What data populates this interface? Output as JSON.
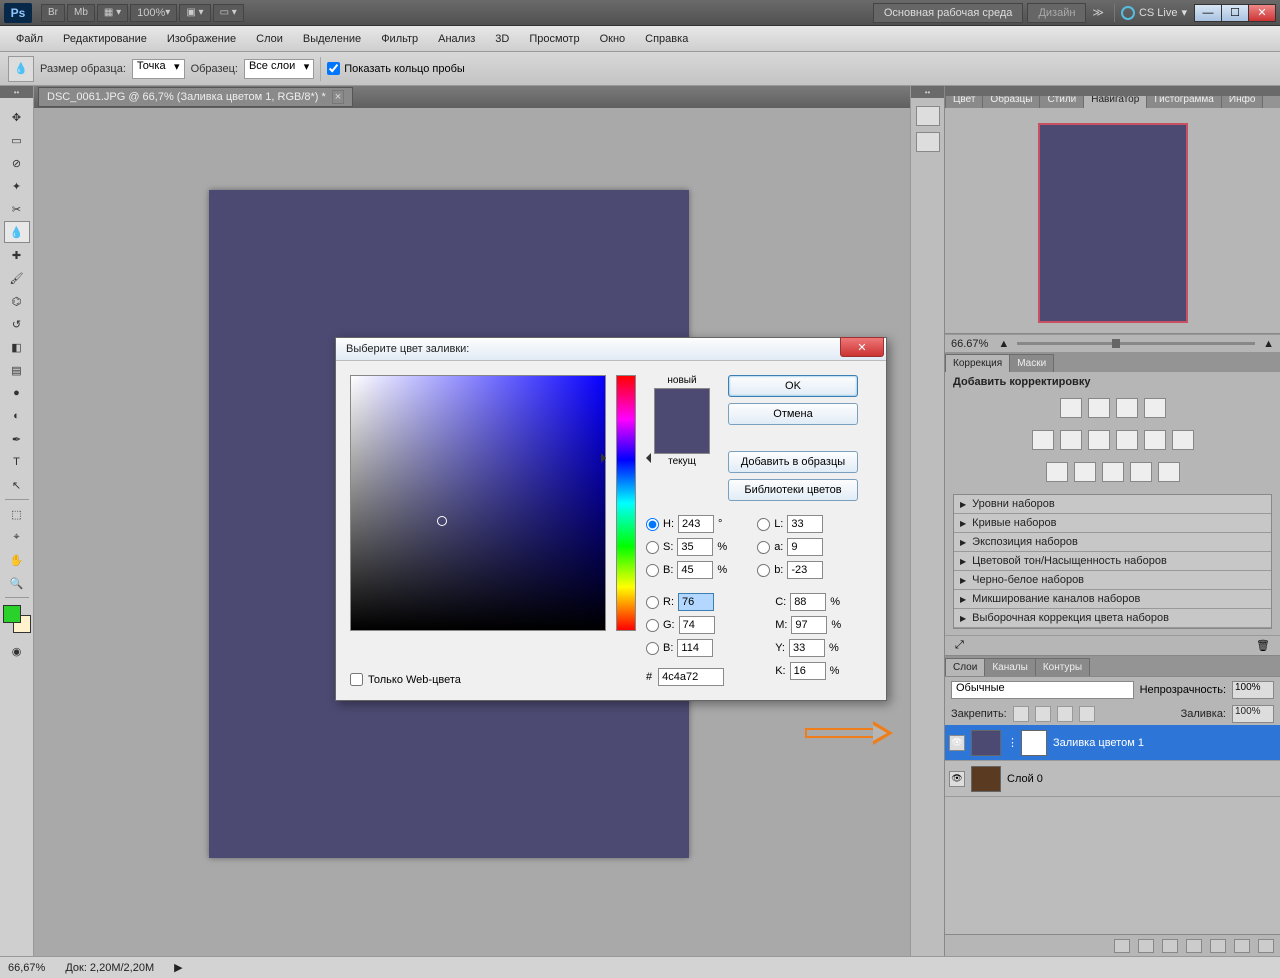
{
  "topbar": {
    "zoom_pct": "100%",
    "workspace_main": "Основная рабочая среда",
    "workspace_design": "Дизайн",
    "cslive": "CS Live"
  },
  "menu": [
    "Файл",
    "Редактирование",
    "Изображение",
    "Слои",
    "Выделение",
    "Фильтр",
    "Анализ",
    "3D",
    "Просмотр",
    "Окно",
    "Справка"
  ],
  "options": {
    "sample_size_lbl": "Размер образца:",
    "sample_size_val": "Точка",
    "sample_lbl": "Образец:",
    "sample_val": "Все слои",
    "show_ring": "Показать кольцо пробы"
  },
  "doc": {
    "tab": "DSC_0061.JPG @ 66,7% (Заливка цветом 1, RGB/8*) *"
  },
  "panel_tabs_top": [
    "Цвет",
    "Образцы",
    "Стили",
    "Навигатор",
    "Гистограмма",
    "Инфо"
  ],
  "nav_zoom": "66.67%",
  "panel_tabs_mid": [
    "Коррекция",
    "Маски"
  ],
  "corrections": {
    "title": "Добавить корректировку",
    "presets": [
      "Уровни наборов",
      "Кривые наборов",
      "Экспозиция наборов",
      "Цветовой тон/Насыщенность наборов",
      "Черно-белое наборов",
      "Микширование каналов наборов",
      "Выборочная коррекция цвета наборов"
    ]
  },
  "panel_tabs_layers": [
    "Слои",
    "Каналы",
    "Контуры"
  ],
  "layers": {
    "blend": "Обычные",
    "opacity_lbl": "Непрозрачность:",
    "opacity_val": "100%",
    "lock_lbl": "Закрепить:",
    "fill_lbl": "Заливка:",
    "fill_val": "100%",
    "rows": [
      {
        "name": "Заливка цветом 1"
      },
      {
        "name": "Слой 0"
      }
    ]
  },
  "picker": {
    "title": "Выберите цвет заливки:",
    "new_lbl": "новый",
    "cur_lbl": "текущ",
    "ok": "OK",
    "cancel": "Отмена",
    "add_swatch": "Добавить в образцы",
    "libs": "Библиотеки цветов",
    "H": "243",
    "S": "35",
    "Bv": "45",
    "R": "76",
    "G": "74",
    "Bb": "114",
    "L": "33",
    "a": "9",
    "b": "-23",
    "C": "88",
    "M": "97",
    "Y": "33",
    "K": "16",
    "hex": "4c4a72",
    "web_only": "Только Web-цвета"
  },
  "status": {
    "zoom": "66,67%",
    "doc": "Док: 2,20M/2,20M"
  }
}
